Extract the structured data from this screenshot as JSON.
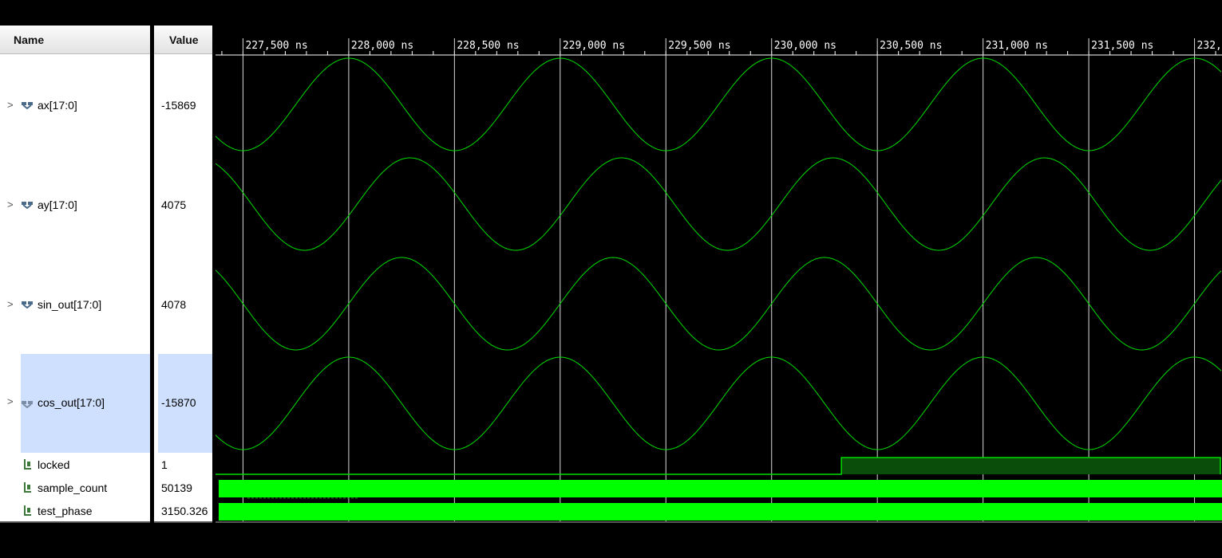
{
  "columns": {
    "name_header": "Name",
    "value_header": "Value"
  },
  "signals": [
    {
      "name": "ax[17:0]",
      "value": "-15869",
      "type": "bus",
      "selected": false
    },
    {
      "name": "ay[17:0]",
      "value": "4075",
      "type": "bus",
      "selected": false
    },
    {
      "name": "sin_out[17:0]",
      "value": "4078",
      "type": "bus",
      "selected": false
    },
    {
      "name": "cos_out[17:0]",
      "value": "-15870",
      "type": "bus",
      "selected": true
    },
    {
      "name": "locked",
      "value": "1",
      "type": "bit",
      "selected": false
    },
    {
      "name": "sample_count",
      "value": "50139",
      "type": "bit",
      "selected": false
    },
    {
      "name": "test_phase",
      "value": "3150.326",
      "type": "bit",
      "selected": false
    }
  ],
  "timeline": {
    "unit": "ns",
    "ticks": [
      "227,500 ns",
      "228,000 ns",
      "228,500 ns",
      "229,000 ns",
      "229,500 ns",
      "230,000 ns",
      "230,500 ns",
      "231,000 ns",
      "231,500 ns",
      "232,000 ns"
    ],
    "tick_values_ns": [
      227500,
      228000,
      228500,
      229000,
      229500,
      230000,
      230500,
      231000,
      231500,
      232000
    ],
    "view_start_ns": 227370,
    "view_end_ns": 232130
  },
  "waveform": {
    "sine_period_ns": 1000,
    "traces": [
      {
        "signal": "ax[17:0]",
        "peak_ns": 228000
      },
      {
        "signal": "ay[17:0]",
        "peak_ns": 228290
      },
      {
        "signal": "sin_out[17:0]",
        "peak_ns": 228250
      },
      {
        "signal": "cos_out[17:0]",
        "peak_ns": 228000
      }
    ],
    "locked_rise_ns": 230330
  },
  "colors": {
    "wave": "#00dd00",
    "bus_fill": "#00ff00",
    "locked_fill": "#0a4d0a",
    "gridline": "#d8d8d8",
    "selection": "#cfe0ff"
  }
}
